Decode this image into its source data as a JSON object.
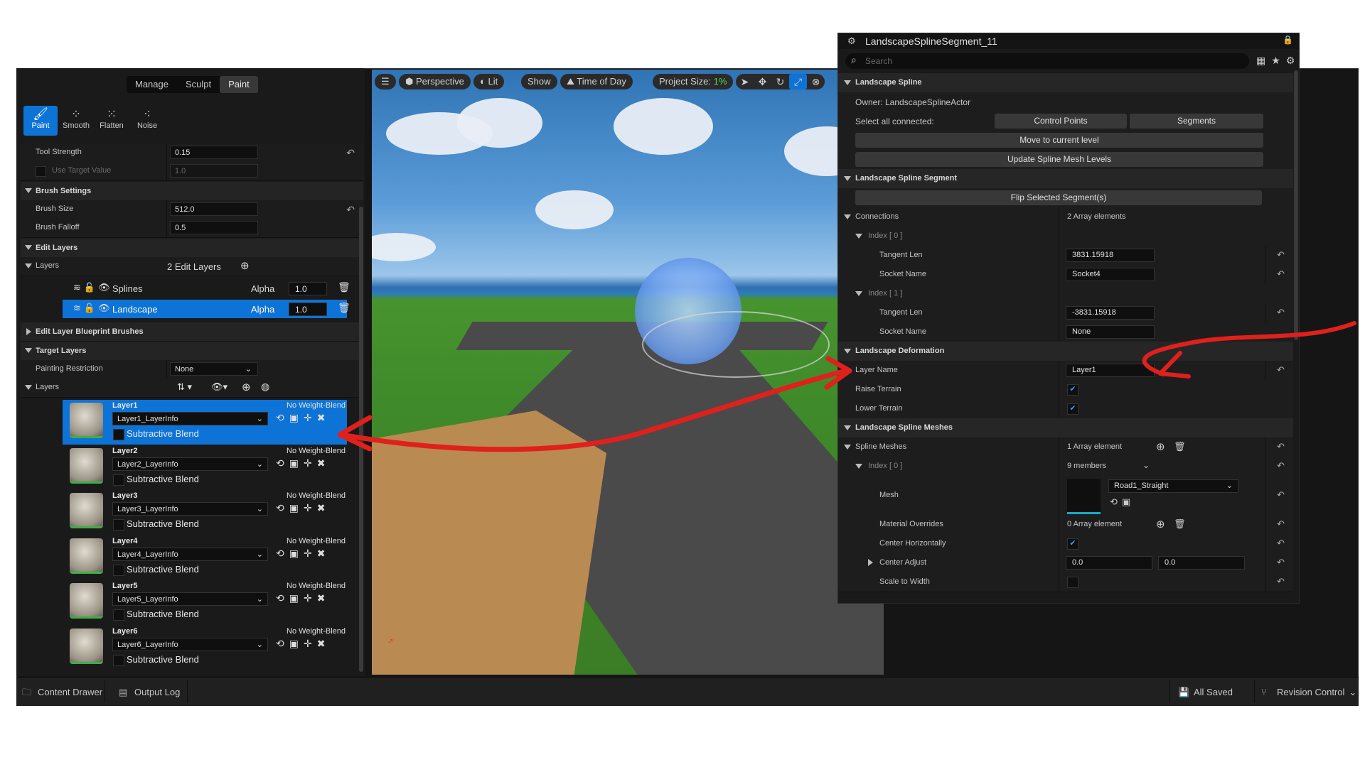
{
  "left_panel": {
    "modes": [
      "Manage",
      "Sculpt",
      "Paint"
    ],
    "active_mode": "Paint",
    "tools": [
      {
        "label": "Paint",
        "icon": "brush-icon"
      },
      {
        "label": "Smooth",
        "icon": "smooth-icon"
      },
      {
        "label": "Flatten",
        "icon": "flatten-icon"
      },
      {
        "label": "Noise",
        "icon": "noise-icon"
      }
    ],
    "tool_strength_label": "Tool Strength",
    "tool_strength": "0.15",
    "use_target_value_label": "Use Target Value",
    "use_target_value": "1.0",
    "brush_settings": "Brush Settings",
    "brush_size_label": "Brush Size",
    "brush_size": "512.0",
    "brush_falloff_label": "Brush Falloff",
    "brush_falloff": "0.5",
    "edit_layers": "Edit Layers",
    "layers_label": "Layers",
    "edit_layers_count": "2 Edit Layers",
    "edit_layer_items": [
      {
        "name": "Splines",
        "alpha_label": "Alpha",
        "alpha": "1.0"
      },
      {
        "name": "Landscape",
        "alpha_label": "Alpha",
        "alpha": "1.0"
      }
    ],
    "blueprint_brushes": "Edit Layer Blueprint Brushes",
    "target_layers": "Target Layers",
    "painting_restriction_label": "Painting Restriction",
    "painting_restriction": "None",
    "target_layers_label": "Layers",
    "target_layer_items": [
      {
        "name": "Layer1",
        "info": "Layer1_LayerInfo",
        "blend": "No Weight-Blend",
        "subtractive": "Subtractive Blend"
      },
      {
        "name": "Layer2",
        "info": "Layer2_LayerInfo",
        "blend": "No Weight-Blend",
        "subtractive": "Subtractive Blend"
      },
      {
        "name": "Layer3",
        "info": "Layer3_LayerInfo",
        "blend": "No Weight-Blend",
        "subtractive": "Subtractive Blend"
      },
      {
        "name": "Layer4",
        "info": "Layer4_LayerInfo",
        "blend": "No Weight-Blend",
        "subtractive": "Subtractive Blend"
      },
      {
        "name": "Layer5",
        "info": "Layer5_LayerInfo",
        "blend": "No Weight-Blend",
        "subtractive": "Subtractive Blend"
      },
      {
        "name": "Layer6",
        "info": "Layer6_LayerInfo",
        "blend": "No Weight-Blend",
        "subtractive": "Subtractive Blend"
      }
    ]
  },
  "viewport": {
    "perspective": "Perspective",
    "lit": "Lit",
    "show": "Show",
    "time_of_day": "Time of Day",
    "project_size_label": "Project Size:",
    "project_size": "1%"
  },
  "details": {
    "title": "LandscapeSplineSegment_11",
    "search_placeholder": "Search",
    "landscape_spline": "Landscape Spline",
    "owner": "Owner: LandscapeSplineActor",
    "select_all_connected": "Select all connected:",
    "control_points": "Control Points",
    "segments": "Segments",
    "move_to_current_level": "Move to current level",
    "update_spline_mesh_levels": "Update Spline Mesh Levels",
    "landscape_spline_segment": "Landscape Spline Segment",
    "flip_selected_segments": "Flip Selected Segment(s)",
    "connections": "Connections",
    "connections_value": "2 Array elements",
    "index0": "Index [ 0 ]",
    "tangent_len": "Tangent Len",
    "tangent_len_0": "3831.15918",
    "socket_name": "Socket Name",
    "socket_name_0": "Socket4",
    "index1": "Index [ 1 ]",
    "tangent_len_1": "-3831.15918",
    "socket_name_1": "None",
    "landscape_deformation": "Landscape Deformation",
    "layer_name": "Layer Name",
    "layer_name_value": "Layer1",
    "raise_terrain": "Raise Terrain",
    "lower_terrain": "Lower Terrain",
    "landscape_spline_meshes": "Landscape Spline Meshes",
    "spline_meshes": "Spline Meshes",
    "spline_meshes_value": "1 Array element",
    "mesh_index0": "Index [ 0 ]",
    "members": "9 members",
    "mesh": "Mesh",
    "mesh_value": "Road1_Straight",
    "material_overrides": "Material Overrides",
    "material_overrides_value": "0 Array element",
    "center_horizontally": "Center Horizontally",
    "center_adjust": "Center Adjust",
    "center_adjust_x": "0.0",
    "center_adjust_y": "0.0",
    "scale_to_width": "Scale to Width"
  },
  "bottom_bar": {
    "content_drawer": "Content Drawer",
    "output_log": "Output Log",
    "all_saved": "All Saved",
    "revision_control": "Revision Control"
  },
  "colors": {
    "accent": "#0e73d6",
    "annotation": "#e0201c",
    "project_size": "#58d25a"
  }
}
